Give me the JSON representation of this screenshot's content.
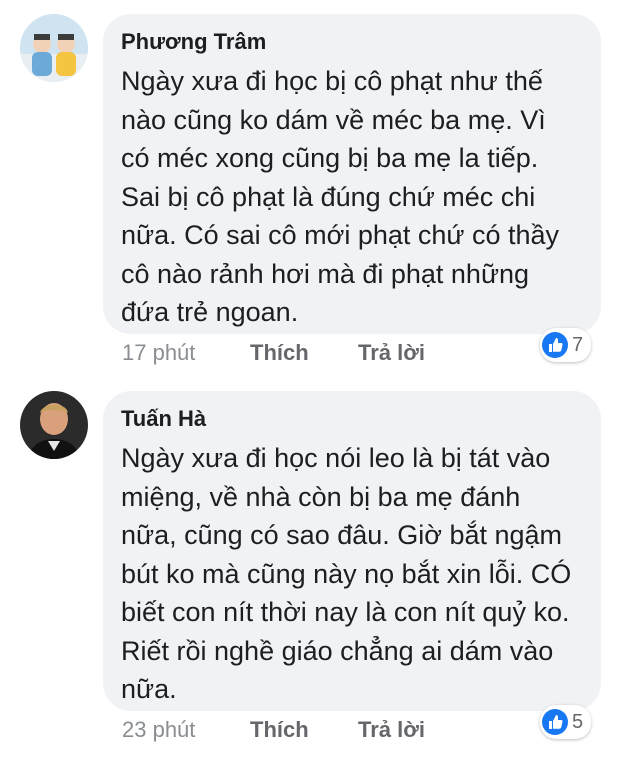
{
  "comments": [
    {
      "author": "Phương Trâm",
      "avatar_icon": "profile-photo",
      "text": "Ngày xưa đi học bị cô phạt như thế nào cũng ko dám về méc ba mẹ. Vì có méc xong cũng bị ba mẹ la tiếp. Sai bị cô phạt là đúng chứ méc chi nữa. Có sai cô mới phạt chứ có thầy cô nào rảnh hơi mà đi phạt những đứa trẻ ngoan.",
      "time": "17 phút",
      "like_label": "Thích",
      "reply_label": "Trả lời",
      "reaction_icon": "like-icon",
      "reaction_count": "7"
    },
    {
      "author": "Tuấn Hà",
      "avatar_icon": "profile-photo",
      "text": "Ngày xưa đi học nói leo là bị tát vào miệng, về nhà còn bị ba mẹ đánh nữa, cũng có sao đâu. Giờ bắt ngậm bút ko mà cũng này nọ bắt xin lỗi. CÓ biết con nít thời nay là con nít quỷ ko. Riết rồi nghề giáo chẳng ai dám vào nữa.",
      "time": "23 phút",
      "like_label": "Thích",
      "reply_label": "Trả lời",
      "reaction_icon": "like-icon",
      "reaction_count": "5"
    }
  ],
  "colors": {
    "bubble": "#f0f2f5",
    "like_blue": "#1877f2",
    "meta_gray": "#8a8d91"
  }
}
